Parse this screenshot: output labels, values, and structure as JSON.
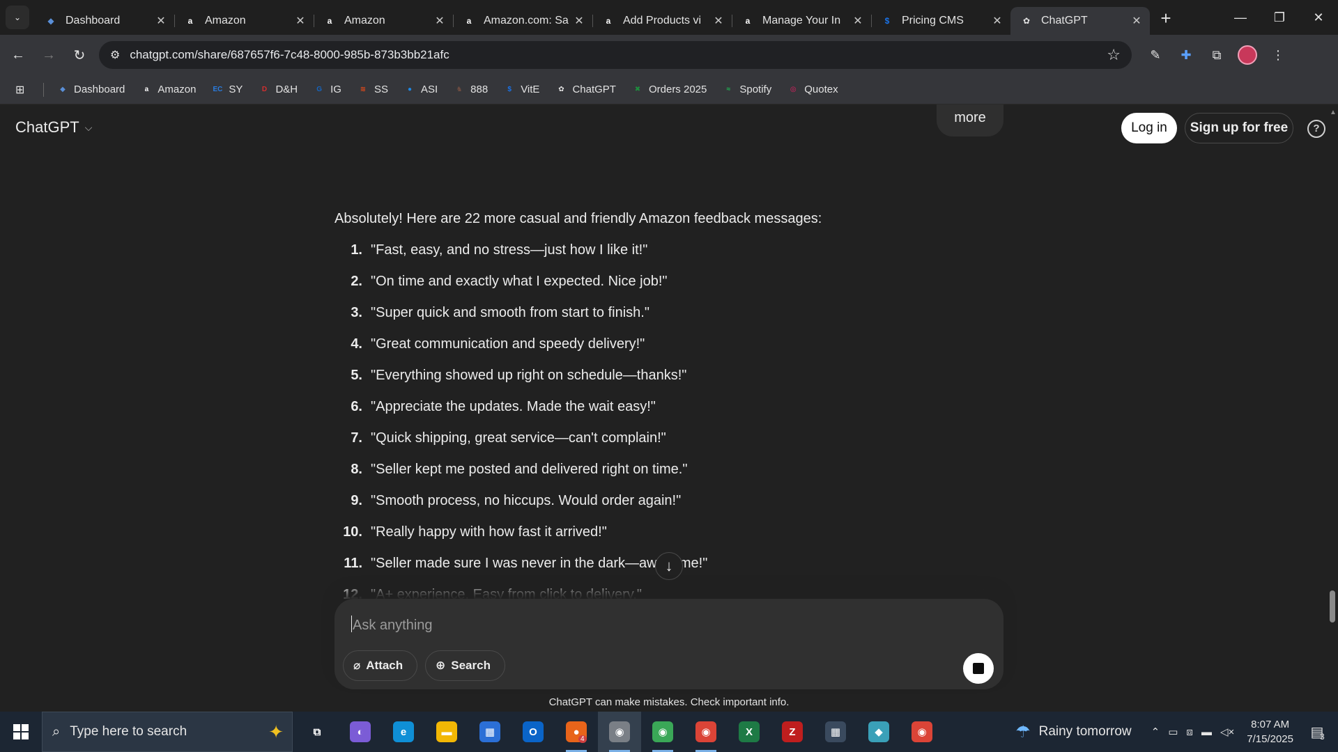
{
  "browser": {
    "tabs": [
      {
        "title": "Dashboard",
        "icon": "dashboard-icon",
        "color": "#5a8fd8",
        "glyph": "◆"
      },
      {
        "title": "Amazon",
        "icon": "amazon-icon",
        "color": "#ffffff",
        "glyph": "a"
      },
      {
        "title": "Amazon",
        "icon": "amazon-icon",
        "color": "#ffffff",
        "glyph": "a"
      },
      {
        "title": "Amazon.com: Sa",
        "icon": "amazon-icon",
        "color": "#ffffff",
        "glyph": "a"
      },
      {
        "title": "Add Products vi",
        "icon": "amazon-icon",
        "color": "#ffffff",
        "glyph": "a"
      },
      {
        "title": "Manage Your In",
        "icon": "amazon-icon",
        "color": "#ffffff",
        "glyph": "a"
      },
      {
        "title": "Pricing CMS",
        "icon": "dollar-icon",
        "color": "#1a73e8",
        "glyph": "$"
      },
      {
        "title": "ChatGPT",
        "icon": "chatgpt-icon",
        "color": "#e3e3e3",
        "glyph": "✿"
      }
    ],
    "active_tab": 7,
    "url": "chatgpt.com/share/687657f6-7c48-8000-985b-873b3bb21afc",
    "bookmarks": [
      {
        "label": "Dashboard",
        "icon": "dashboard-icon",
        "color": "#5a8fd8",
        "glyph": "◆"
      },
      {
        "label": "Amazon",
        "icon": "amazon-icon",
        "color": "#ffffff",
        "glyph": "a"
      },
      {
        "label": "SY",
        "icon": "ec-icon",
        "color": "#2a7de1",
        "glyph": "EC"
      },
      {
        "label": "D&H",
        "icon": "dh-icon",
        "color": "#d32f2f",
        "glyph": "D"
      },
      {
        "label": "IG",
        "icon": "ig-icon",
        "color": "#1565c0",
        "glyph": "G"
      },
      {
        "label": "SS",
        "icon": "ss-icon",
        "color": "#e64a19",
        "glyph": "≋"
      },
      {
        "label": "ASI",
        "icon": "asi-icon",
        "color": "#1e88e5",
        "glyph": "●"
      },
      {
        "label": "888",
        "icon": "888-icon",
        "color": "#6d4c41",
        "glyph": "♞"
      },
      {
        "label": "VitE",
        "icon": "vite-icon",
        "color": "#1a73e8",
        "glyph": "$"
      },
      {
        "label": "ChatGPT",
        "icon": "chatgpt-icon",
        "color": "#e3e3e3",
        "glyph": "✿"
      },
      {
        "label": "Orders 2025",
        "icon": "sheets-icon",
        "color": "#1e8e3e",
        "glyph": "✖"
      },
      {
        "label": "Spotify",
        "icon": "spotify-icon",
        "color": "#1db954",
        "glyph": "≈"
      },
      {
        "label": "Quotex",
        "icon": "quotex-icon",
        "color": "#e91e63",
        "glyph": "◎"
      }
    ]
  },
  "header": {
    "brand": "ChatGPT",
    "more_label": "more",
    "login_label": "Log in",
    "signup_label": "Sign up for free",
    "help_label": "?"
  },
  "thread": {
    "intro": "Absolutely! Here are 22 more casual and friendly Amazon feedback messages:",
    "items": [
      {
        "num": "1.",
        "text": "\"Fast, easy, and no stress—just how I like it!\""
      },
      {
        "num": "2.",
        "text": "\"On time and exactly what I expected. Nice job!\""
      },
      {
        "num": "3.",
        "text": "\"Super quick and smooth from start to finish.\""
      },
      {
        "num": "4.",
        "text": "\"Great communication and speedy delivery!\""
      },
      {
        "num": "5.",
        "text": "\"Everything showed up right on schedule—thanks!\""
      },
      {
        "num": "6.",
        "text": "\"Appreciate the updates. Made the wait easy!\""
      },
      {
        "num": "7.",
        "text": "\"Quick shipping, great service—can't complain!\""
      },
      {
        "num": "8.",
        "text": "\"Seller kept me posted and delivered right on time.\""
      },
      {
        "num": "9.",
        "text": "\"Smooth process, no hiccups. Would order again!\""
      },
      {
        "num": "10.",
        "text": "\"Really happy with how fast it arrived!\""
      },
      {
        "num": "11.",
        "text": "\"Seller made sure I was never in the dark—awesome!\""
      },
      {
        "num": "12.",
        "text": "\"A+ experience. Easy from click to delivery.\""
      }
    ]
  },
  "composer": {
    "placeholder": "Ask anything",
    "attach_label": "Attach",
    "search_label": "Search"
  },
  "disclaimer": "ChatGPT can make mistakes. Check important info.",
  "taskbar": {
    "search_placeholder": "Type here to search",
    "apps": [
      {
        "name": "task-view",
        "glyph": "⧉",
        "color": "#1c2633"
      },
      {
        "name": "copilot",
        "glyph": "◐",
        "color": "#7b5cd6"
      },
      {
        "name": "edge",
        "glyph": "e",
        "color": "#0f8fd6"
      },
      {
        "name": "file-explorer",
        "glyph": "▬",
        "color": "#f2b705"
      },
      {
        "name": "microsoft-store",
        "glyph": "▦",
        "color": "#2b6fd6"
      },
      {
        "name": "outlook",
        "glyph": "O",
        "color": "#0a64c8"
      },
      {
        "name": "firefox",
        "glyph": "●",
        "color": "#e8641a",
        "badge": "4"
      },
      {
        "name": "chrome-profile-1",
        "glyph": "◉",
        "color": "#7a7f86"
      },
      {
        "name": "chrome-profile-2",
        "glyph": "◉",
        "color": "#3aa757"
      },
      {
        "name": "chrome-profile-3",
        "glyph": "◉",
        "color": "#db4437"
      },
      {
        "name": "excel",
        "glyph": "X",
        "color": "#1e7a45"
      },
      {
        "name": "filezilla",
        "glyph": "Z",
        "color": "#bf1e1e"
      },
      {
        "name": "calculator",
        "glyph": "▦",
        "color": "#3a4a5e"
      },
      {
        "name": "app-diamond",
        "glyph": "◆",
        "color": "#3aa0b8"
      },
      {
        "name": "chrome",
        "glyph": "◉",
        "color": "#db4437"
      }
    ],
    "weather": "Rainy tomorrow",
    "time": "8:07 AM",
    "date": "7/15/2025",
    "notifications": "3"
  }
}
